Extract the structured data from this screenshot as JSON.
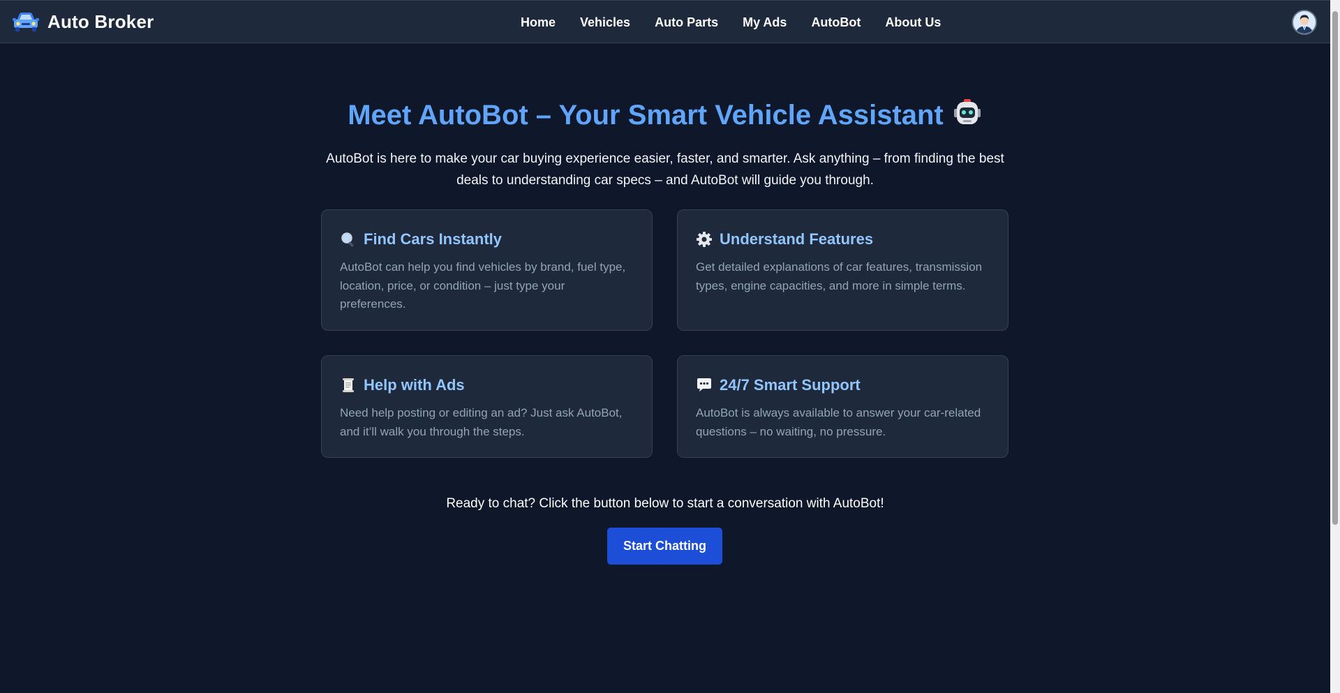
{
  "brand": {
    "name": "Auto Broker",
    "icon": "car-icon"
  },
  "nav": {
    "items": [
      {
        "label": "Home"
      },
      {
        "label": "Vehicles"
      },
      {
        "label": "Auto Parts"
      },
      {
        "label": "My Ads"
      },
      {
        "label": "AutoBot"
      },
      {
        "label": "About Us"
      }
    ]
  },
  "user": {
    "avatar_icon": "user-avatar-icon"
  },
  "hero": {
    "title": "Meet AutoBot – Your Smart Vehicle Assistant",
    "title_icon": "robot-icon",
    "description": "AutoBot is here to make your car buying experience easier, faster, and smarter. Ask anything – from finding the best deals to understanding car specs – and AutoBot will guide you through."
  },
  "features": [
    {
      "icon": "magnifier-icon",
      "title": "Find Cars Instantly",
      "text": "AutoBot can help you find vehicles by brand, fuel type, location, price, or condition – just type your preferences."
    },
    {
      "icon": "gear-icon",
      "title": "Understand Features",
      "text": "Get detailed explanations of car features, transmission types, engine capacities, and more in simple terms."
    },
    {
      "icon": "scroll-icon",
      "title": "Help with Ads",
      "text": "Need help posting or editing an ad? Just ask AutoBot, and it’ll walk you through the steps."
    },
    {
      "icon": "speech-bubble-icon",
      "title": "24/7 Smart Support",
      "text": "AutoBot is always available to answer your car-related questions – no waiting, no pressure."
    }
  ],
  "cta": {
    "text": "Ready to chat? Click the button below to start a conversation with AutoBot!",
    "button_label": "Start Chatting"
  },
  "colors": {
    "background": "#0f172a",
    "surface": "#1e293b",
    "accent": "#60a5fa",
    "card_title": "#93c5fd",
    "button": "#1d4ed8"
  }
}
